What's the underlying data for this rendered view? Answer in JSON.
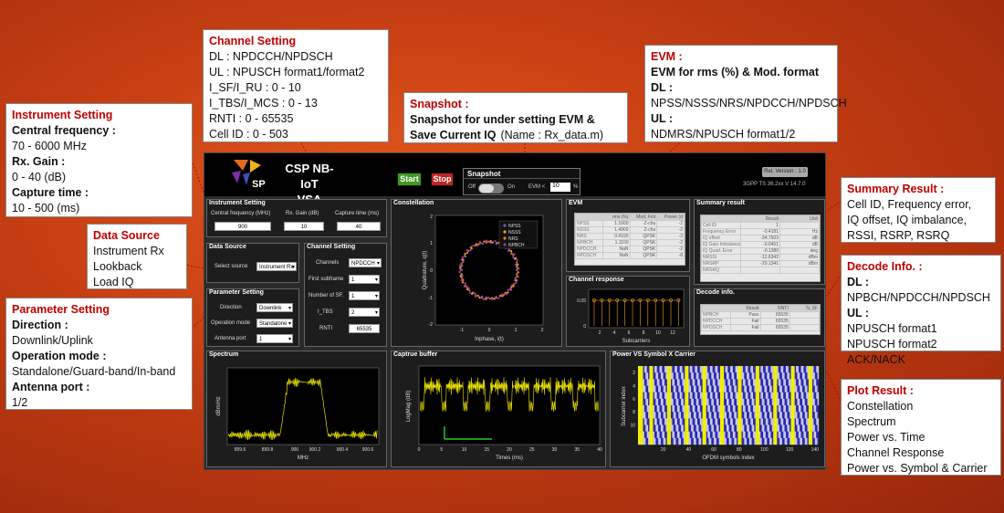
{
  "callouts": {
    "instrument": {
      "title": "Instrument Setting",
      "cf_label": "Central frequency :",
      "cf_range": "70 - 6000 MHz",
      "gain_label": "Rx. Gain :",
      "gain_range": "0 - 40 (dB)",
      "cap_label": "Capture time :",
      "cap_range": "10 - 500 (ms)"
    },
    "datasource": {
      "title": "Data Source",
      "l1": "Instrument Rx",
      "l2": "Lookback",
      "l3": "Load IQ"
    },
    "parameter": {
      "title": "Parameter Setting",
      "dir_label": "Direction :",
      "dir_value": "Downlink/Uplink",
      "mode_label": "Operation mode :",
      "mode_value": "Standalone/Guard-band/In-band",
      "ant_label": "Antenna port :",
      "ant_value": "1/2"
    },
    "channel": {
      "title": "Channel Setting",
      "l1": "DL : NPDCCH/NPDSCH",
      "l2": "UL : NPUSCH format1/format2",
      "l3": "I_SF/I_RU : 0 - 10",
      "l4": "I_TBS/I_MCS : 0 - 13",
      "l5": "RNTI : 0 - 65535",
      "l6": "Cell ID : 0 - 503"
    },
    "snapshot": {
      "title": "Snapshot :",
      "l1": "Snapshot for under setting EVM &",
      "l2a": "Save Current IQ",
      "l2b": "(Name : Rx_data.m)"
    },
    "evm": {
      "title": "EVM :",
      "l1": "EVM for rms (%) & Mod. format",
      "l2": "DL :",
      "l3": "NPSS/NSSS/NRS/NPDCCH/NPDSCH",
      "l4": "UL :",
      "l5": "NDMRS/NPUSCH format1/2"
    },
    "summary": {
      "title": "Summary Result :",
      "l1": "Cell ID, Frequency error,",
      "l2": "IQ offset, IQ imbalance,",
      "l3": "RSSI, RSRP, RSRQ"
    },
    "decode": {
      "title": "Decode Info. :",
      "l1": "DL :",
      "l2": "NPBCH/NPDCCH/NPDSCH",
      "l3": "UL :",
      "l4": "NPUSCH format1",
      "l5": "NPUSCH format2 ACK/NACK"
    },
    "plot": {
      "title": "Plot Result :",
      "l1": "Constellation",
      "l2": "Spectrum",
      "l3": "Power vs. Time",
      "l4": "Channel Response",
      "l5": "Power vs. Symbol & Carrier"
    }
  },
  "app": {
    "title_line1": "CSP NB-IoT",
    "title_line2": "VSA",
    "logo_text": "SP",
    "start": "Start",
    "stop": "Stop",
    "snapshot": {
      "title": "Snapshot",
      "off": "Off",
      "on": "On",
      "evm_label": "EVM <",
      "evm_value": "10",
      "unit": "%"
    },
    "release": "Rel. Version : 1.0",
    "standard": "3GPP TS 36.2xx  V 14.7.0",
    "instrument": {
      "title": "Instrument Setting",
      "cf_label": "Central frequency (MHz)",
      "cf_value": "900",
      "gain_label": "Rx. Gain (dB)",
      "gain_value": "10",
      "cap_label": "Capture time (ms)",
      "cap_value": "40"
    },
    "datasource": {
      "title": "Data Source",
      "label": "Select source",
      "value": "Instrument Rx"
    },
    "parameter": {
      "title": "Parameter Setting",
      "dir_label": "Direction",
      "dir_value": "Downlink",
      "mode_label": "Operation mode",
      "mode_value": "Standalone",
      "ant_label": "Antenna port",
      "ant_value": "1"
    },
    "channel": {
      "title": "Channel Setting",
      "ch_label": "Channels",
      "ch_value": "NPDCCH",
      "fs_label": "First subframe",
      "fs_value": "1",
      "nsf_label": "Number of SF.",
      "nsf_value": "1",
      "itbs_label": "I_TBS",
      "itbs_value": "2",
      "rnti_label": "RNTI",
      "rnti_value": "65535"
    },
    "constellation": {
      "title": "Constellation",
      "xlabel": "Inphase, i(t)",
      "ylabel": "Quadrature, q(t)",
      "legend": [
        {
          "name": "NPSS",
          "color": "#6a5acd"
        },
        {
          "name": "NSSS",
          "color": "#f0a020"
        },
        {
          "name": "NRS",
          "color": "#f08020"
        },
        {
          "name": "NPBCH",
          "color": "#8a3cb0"
        }
      ],
      "xticks": [
        "-1",
        "0",
        "1",
        "2"
      ],
      "yticks": [
        "2",
        "1",
        "0",
        "-1",
        "-2"
      ]
    },
    "evm": {
      "title": "EVM",
      "headers": [
        "",
        "rms (%)",
        "Mod. Fmt",
        "Power (d"
      ],
      "rows": [
        [
          "NPSS",
          "1.1600",
          "Z-chu",
          "-2"
        ],
        [
          "NSSS",
          "1.4900",
          "Z-chu",
          "-2"
        ],
        [
          "NRS",
          "0.4100",
          "QPSK",
          "-3"
        ],
        [
          "NPBCH",
          "1.1100",
          "QPSK",
          "-2"
        ],
        [
          "NPDCCH",
          "NaN",
          "QPSK",
          "-2"
        ],
        [
          "NPDSCH",
          "NaN",
          "QPSK",
          "-8"
        ]
      ]
    },
    "summary": {
      "title": "Summary result",
      "headers": [
        "",
        "Result",
        "Unit"
      ],
      "rows": [
        [
          "Cell ID",
          "1",
          ""
        ],
        [
          "Frequency Error",
          "-0.4181",
          "Hz"
        ],
        [
          "IQ offset",
          "-34.7503",
          "dB"
        ],
        [
          "IQ Gain Imbalance",
          "-0.0451",
          "dB"
        ],
        [
          "IQ Quad. Error",
          "-0.1380",
          "deg"
        ],
        [
          "NRSSI",
          "-12.6342",
          "dBm"
        ],
        [
          "NRSRP",
          "-20.1341",
          "dBm"
        ],
        [
          "NRSRQ",
          "",
          ""
        ]
      ]
    },
    "chresp": {
      "title": "Channel response",
      "xlabel": "Subcarriers",
      "yticks": [
        "0.05",
        "0"
      ],
      "xticks": [
        "2",
        "4",
        "6",
        "8",
        "10",
        "12"
      ]
    },
    "decode": {
      "title": "Decode info.",
      "headers": [
        "",
        "Result",
        "RNTI",
        "N_SF"
      ],
      "rows": [
        [
          "NPBCH",
          "Pass",
          "65535",
          ""
        ],
        [
          "NPDCCH",
          "Fail",
          "65535",
          ""
        ],
        [
          "NPDSCH",
          "Fail",
          "65535",
          ""
        ]
      ]
    },
    "spectrum": {
      "title": "Spectrum",
      "xlabel": "MHz",
      "ylabel": "dBm/Hz",
      "xticks": [
        "899.6",
        "899.8",
        "900",
        "900.2",
        "900.4",
        "900.6"
      ]
    },
    "buffer": {
      "title": "Captrue buffer",
      "xlabel": "Times (ms)",
      "ylabel": "LogMag (dB)",
      "xticks": [
        "0",
        "5",
        "10",
        "15",
        "20",
        "25",
        "30",
        "35",
        "40"
      ]
    },
    "powersym": {
      "title": "Power VS Symbol X Carrier",
      "xlabel": "OFDM symbols index",
      "ylabel": "Subcarrier index",
      "xticks": [
        "20",
        "40",
        "60",
        "80",
        "100",
        "120",
        "140"
      ],
      "yticks": [
        "2",
        "4",
        "6",
        "8",
        "10"
      ]
    }
  }
}
